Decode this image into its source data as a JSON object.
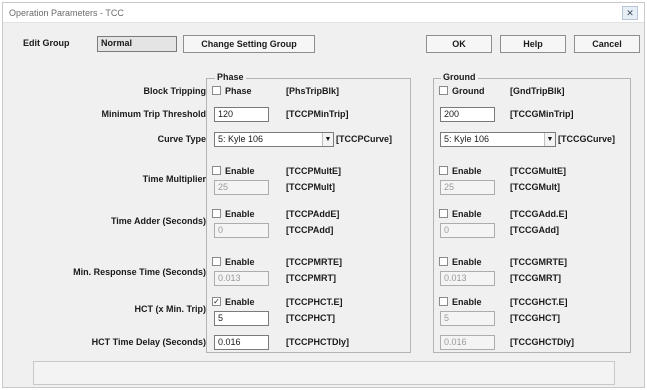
{
  "window": {
    "title": "Operation Parameters - TCC",
    "close_glyph": "✕"
  },
  "header": {
    "edit_group_label": "Edit Group",
    "edit_group_value": "Normal",
    "change_button": "Change Setting Group",
    "ok_button": "OK",
    "help_button": "Help",
    "cancel_button": "Cancel"
  },
  "rows": {
    "block_tripping": "Block Tripping",
    "min_trip": "Minimum Trip Threshold",
    "curve_type": "Curve Type",
    "time_multiplier": "Time Multiplier",
    "time_adder": "Time Adder (Seconds)",
    "min_response": "Min. Response Time (Seconds)",
    "hct": "HCT (x Min. Trip)",
    "hct_delay": "HCT Time Delay (Seconds)"
  },
  "phase": {
    "title": "Phase",
    "block_check_label": "Phase",
    "block_tag": "[PhsTripBlk]",
    "min_trip_value": "120",
    "min_trip_tag": "[TCCPMinTrip]",
    "curve_value": "5: Kyle 106",
    "curve_tag": "[TCCPCurve]",
    "tm_enable": "Enable",
    "tm_enable_tag": "[TCCPMultE]",
    "tm_value": "25",
    "tm_tag": "[TCCPMult]",
    "ta_enable": "Enable",
    "ta_enable_tag": "[TCCPAddE]",
    "ta_value": "0",
    "ta_tag": "[TCCPAdd]",
    "mr_enable": "Enable",
    "mr_enable_tag": "[TCCPMRTE]",
    "mr_value": "0.013",
    "mr_tag": "[TCCPMRT]",
    "hct_enable": "Enable",
    "hct_enable_tag": "[TCCPHCT.E]",
    "hct_value": "5",
    "hct_tag": "[TCCPHCT]",
    "hctd_value": "0.016",
    "hctd_tag": "[TCCPHCTDly]",
    "hct_checked": "✓"
  },
  "ground": {
    "title": "Ground",
    "block_check_label": "Ground",
    "block_tag": "[GndTripBlk]",
    "min_trip_value": "200",
    "min_trip_tag": "[TCCGMinTrip]",
    "curve_value": "5: Kyle 106",
    "curve_tag": "[TCCGCurve]",
    "tm_enable": "Enable",
    "tm_enable_tag": "[TCCGMultE]",
    "tm_value": "25",
    "tm_tag": "[TCCGMult]",
    "ta_enable": "Enable",
    "ta_enable_tag": "[TCCGAdd.E]",
    "ta_value": "0",
    "ta_tag": "[TCCGAdd]",
    "mr_enable": "Enable",
    "mr_enable_tag": "[TCCGMRTE]",
    "mr_value": "0.013",
    "mr_tag": "[TCCGMRT]",
    "hct_enable": "Enable",
    "hct_enable_tag": "[TCCGHCT.E]",
    "hct_value": "5",
    "hct_tag": "[TCCGHCT]",
    "hctd_value": "0.016",
    "hctd_tag": "[TCCGHCTDly]"
  },
  "icons": {
    "dropdown_arrow": "▼"
  }
}
